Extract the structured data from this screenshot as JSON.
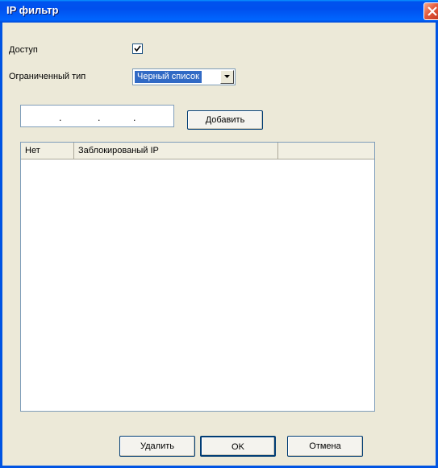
{
  "window": {
    "title": "IP фильтр"
  },
  "form": {
    "enabled_label": "Доступ",
    "enabled_checked": true,
    "restrict_type_label": "Ограниченный тип",
    "restrict_type_value": "Черный список"
  },
  "ip_entry": {
    "dots": [
      ".",
      ".",
      "."
    ]
  },
  "buttons": {
    "add": "Добавить",
    "delete": "Удалить",
    "ok": "OK",
    "cancel": "Отмена"
  },
  "table": {
    "columns": [
      "Нет",
      "Заблокированый IP",
      ""
    ],
    "rows": []
  },
  "icons": {
    "close": "close-icon",
    "check": "checkmark-icon",
    "dropdown": "chevron-down-icon"
  }
}
